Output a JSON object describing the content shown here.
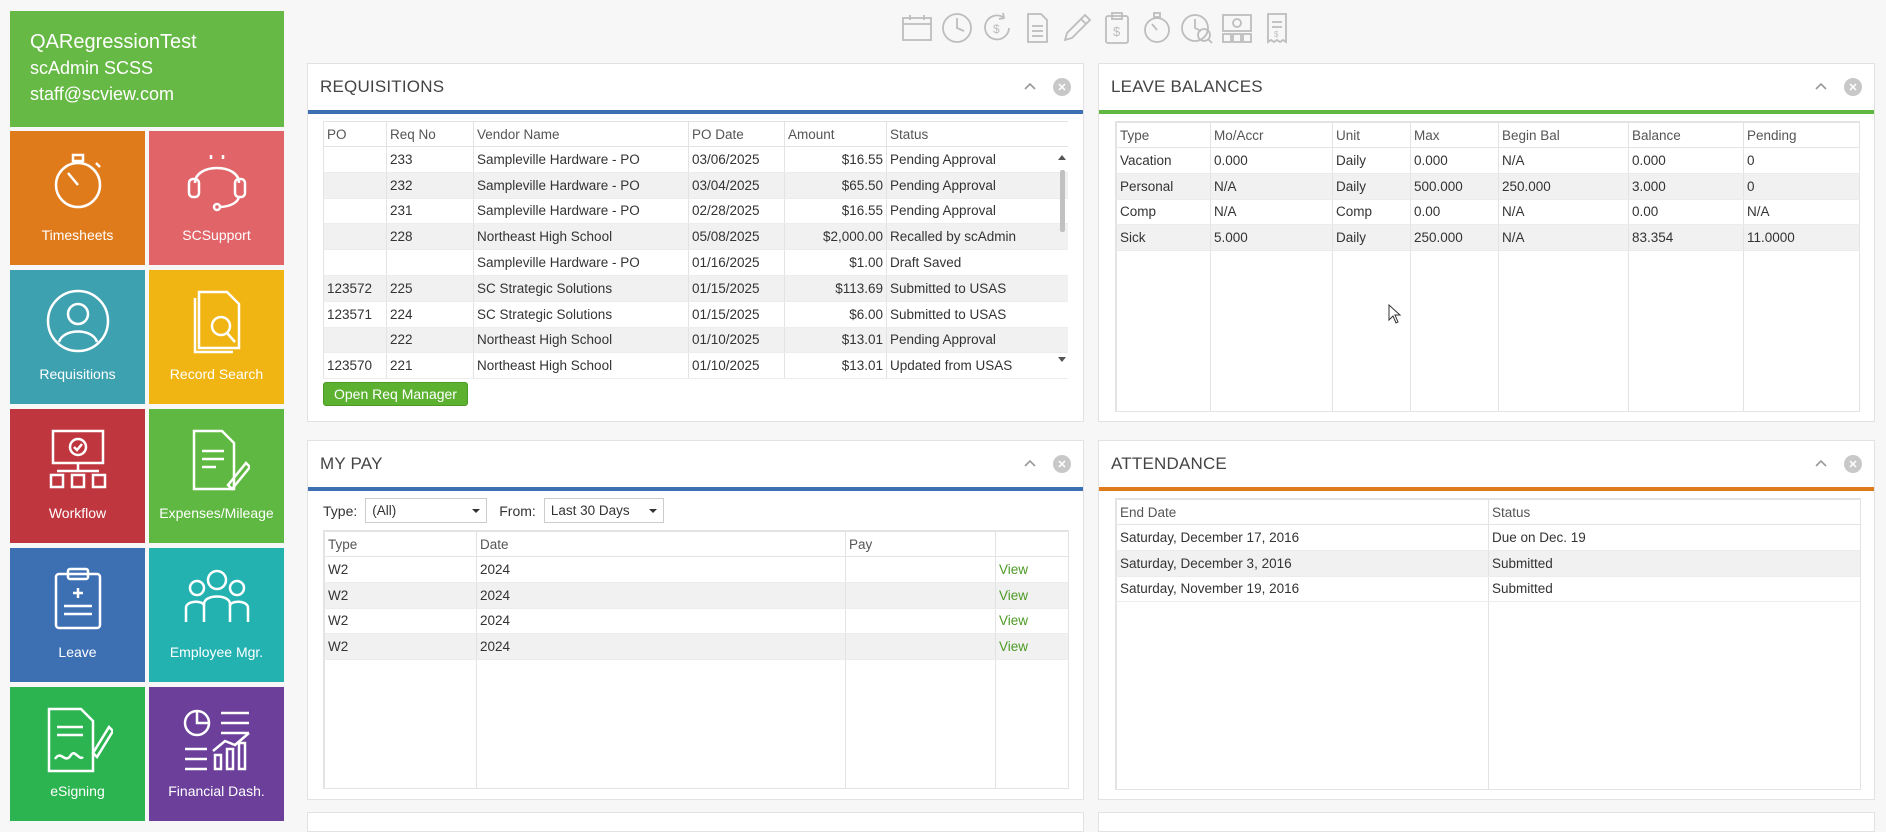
{
  "user": {
    "org": "QARegressionTest",
    "name": "scAdmin SCSS",
    "email": "staff@scview.com"
  },
  "tiles": [
    {
      "label": "Timesheets",
      "color": "#e07b1c",
      "icon": "stopwatch-icon"
    },
    {
      "label": "SCSupport",
      "color": "#e06468",
      "icon": "headset-icon"
    },
    {
      "label": "Requisitions",
      "color": "#3ea1b0",
      "icon": "person-icon"
    },
    {
      "label": "Record Search",
      "color": "#f0b413",
      "icon": "document-search-icon"
    },
    {
      "label": "Workflow",
      "color": "#c0363f",
      "icon": "workflow-icon"
    },
    {
      "label": "Expenses/Mileage",
      "color": "#5fb841",
      "icon": "document-pen-icon"
    },
    {
      "label": "Leave",
      "color": "#3d6fb3",
      "icon": "clipboard-icon"
    },
    {
      "label": "Employee Mgr.",
      "color": "#24b2b1",
      "icon": "group-icon"
    },
    {
      "label": "eSigning",
      "color": "#2bb450",
      "icon": "signature-icon"
    },
    {
      "label": "Financial Dash.",
      "color": "#6b3f9a",
      "icon": "financial-chart-icon"
    }
  ],
  "toolbar_icons": [
    "calendar-icon",
    "clock-icon",
    "refresh-dollar-icon",
    "document-icon",
    "pencil-icon",
    "clipboard-dollar-icon",
    "stopwatch-icon",
    "clock-search-icon",
    "money-grid-icon",
    "receipt-icon"
  ],
  "requisitions": {
    "title": "REQUISITIONS",
    "bar_color": "#3d6fb3",
    "columns": [
      "PO",
      "Req No",
      "Vendor Name",
      "PO Date",
      "Amount",
      "Status"
    ],
    "rows": [
      [
        "",
        "233",
        "Sampleville Hardware - PO",
        "03/06/2025",
        "$16.55",
        "Pending Approval"
      ],
      [
        "",
        "232",
        "Sampleville Hardware - PO",
        "03/04/2025",
        "$65.50",
        "Pending Approval"
      ],
      [
        "",
        "231",
        "Sampleville Hardware - PO",
        "02/28/2025",
        "$16.55",
        "Pending Approval"
      ],
      [
        "",
        "228",
        "Northeast High School",
        "05/08/2025",
        "$2,000.00",
        "Recalled by scAdmin"
      ],
      [
        "",
        "",
        "Sampleville Hardware - PO",
        "01/16/2025",
        "$1.00",
        "Draft Saved"
      ],
      [
        "123572",
        "225",
        "SC Strategic Solutions",
        "01/15/2025",
        "$113.69",
        "Submitted to USAS"
      ],
      [
        "123571",
        "224",
        "SC Strategic Solutions",
        "01/15/2025",
        "$6.00",
        "Submitted to USAS"
      ],
      [
        "",
        "222",
        "Northeast High School",
        "01/10/2025",
        "$13.01",
        "Pending Approval"
      ],
      [
        "123570",
        "221",
        "Northeast High School",
        "01/10/2025",
        "$13.01",
        "Updated from USAS"
      ]
    ],
    "button": "Open Req Manager"
  },
  "leave": {
    "title": "LEAVE BALANCES",
    "bar_color": "#5fb841",
    "columns": [
      "Type",
      "Mo/Accr",
      "Unit",
      "Max",
      "Begin Bal",
      "Balance",
      "Pending"
    ],
    "rows": [
      [
        "Vacation",
        "0.000",
        "Daily",
        "0.000",
        "N/A",
        "0.000",
        "0"
      ],
      [
        "Personal",
        "N/A",
        "Daily",
        "500.000",
        "250.000",
        "3.000",
        "0"
      ],
      [
        "Comp",
        "N/A",
        "Comp",
        "0.00",
        "N/A",
        "0.00",
        "N/A"
      ],
      [
        "Sick",
        "5.000",
        "Daily",
        "250.000",
        "N/A",
        "83.354",
        "11.0000"
      ]
    ]
  },
  "mypay": {
    "title": "MY PAY",
    "bar_color": "#3d6fb3",
    "type_label": "Type:",
    "type_value": "(All)",
    "from_label": "From:",
    "from_value": "Last 30 Days",
    "columns": [
      "Type",
      "Date",
      "Pay",
      ""
    ],
    "rows": [
      [
        "W2",
        "2024",
        "",
        "View"
      ],
      [
        "W2",
        "2024",
        "",
        "View"
      ],
      [
        "W2",
        "2024",
        "",
        "View"
      ],
      [
        "W2",
        "2024",
        "",
        "View"
      ]
    ]
  },
  "attendance": {
    "title": "ATTENDANCE",
    "bar_color": "#e07b1c",
    "columns": [
      "End Date",
      "Status"
    ],
    "rows": [
      [
        "Saturday, December 17, 2016",
        "Due on Dec. 19"
      ],
      [
        "Saturday, December 3, 2016",
        "Submitted"
      ],
      [
        "Saturday, November 19, 2016",
        "Submitted"
      ]
    ]
  }
}
